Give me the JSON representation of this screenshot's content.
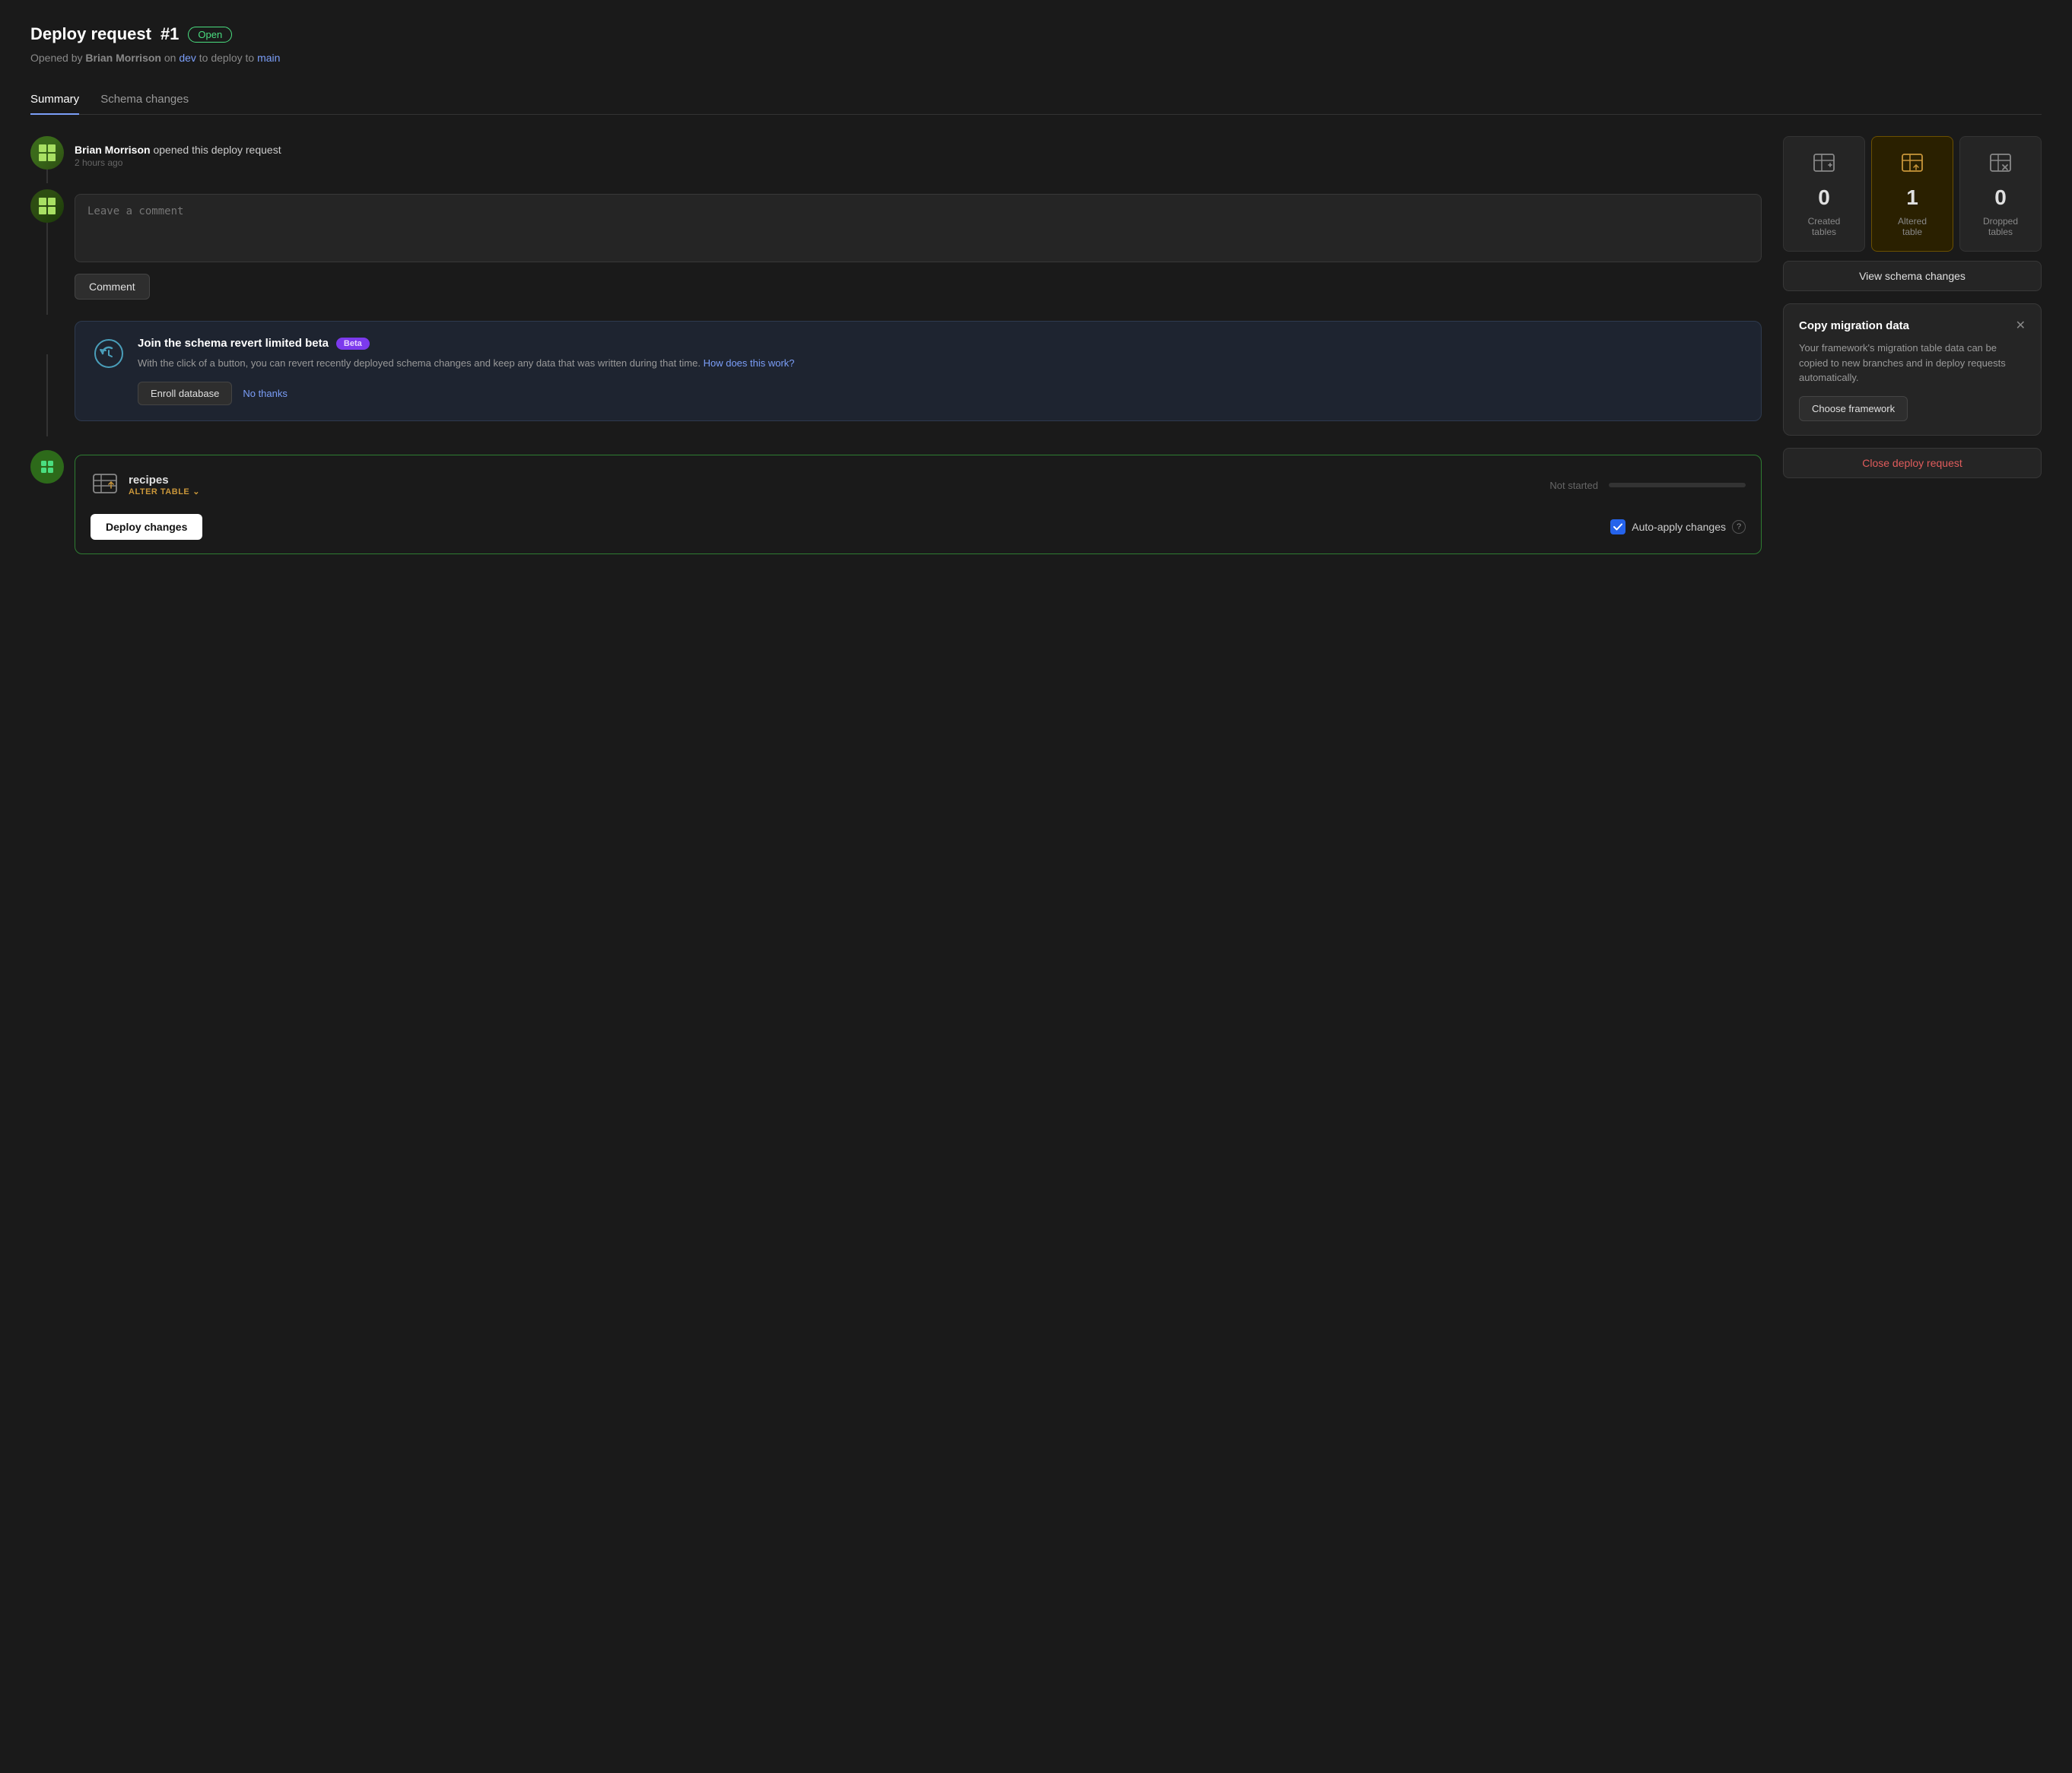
{
  "header": {
    "title": "Deploy request",
    "number": "#1",
    "badge": "Open",
    "subtitle_prefix": "Opened by",
    "author": "Brian Morrison",
    "subtitle_middle": "on",
    "branch_from": "dev",
    "subtitle_to": "to deploy to",
    "branch_to": "main"
  },
  "tabs": [
    {
      "id": "summary",
      "label": "Summary",
      "active": true
    },
    {
      "id": "schema-changes",
      "label": "Schema changes",
      "active": false
    }
  ],
  "timeline": [
    {
      "event_html": "<strong>Brian Morrison</strong> opened this deploy request",
      "time": "2 hours ago"
    }
  ],
  "comment": {
    "placeholder": "Leave a comment",
    "button_label": "Comment"
  },
  "beta_card": {
    "title": "Join the schema revert limited beta",
    "badge": "Beta",
    "description": "With the click of a button, you can revert recently deployed schema changes and keep any data that was written during that time.",
    "link_text": "How does this work?",
    "enroll_label": "Enroll database",
    "no_thanks_label": "No thanks"
  },
  "deploy_table": {
    "name": "recipes",
    "tag": "ALTER TABLE",
    "status": "Not started",
    "deploy_label": "Deploy changes",
    "auto_apply_label": "Auto-apply changes"
  },
  "stats": [
    {
      "number": "0",
      "label": "Created\ntables",
      "highlighted": false,
      "icon": "table-add"
    },
    {
      "number": "1",
      "label": "Altered\ntable",
      "highlighted": true,
      "icon": "table-edit"
    },
    {
      "number": "0",
      "label": "Dropped\ntables",
      "highlighted": false,
      "icon": "table-remove"
    }
  ],
  "view_schema_btn": "View schema changes",
  "migration_card": {
    "title": "Copy migration data",
    "description": "Your framework's migration table data can be copied to new branches and in deploy requests automatically.",
    "choose_framework_label": "Choose framework"
  },
  "close_deploy_btn": "Close deploy request"
}
